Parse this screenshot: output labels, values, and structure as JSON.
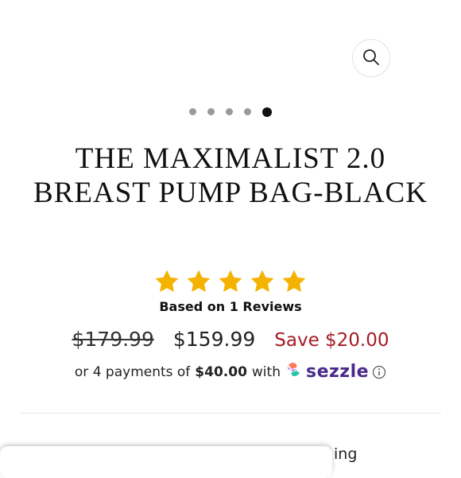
{
  "header": {
    "search_icon": "search-icon"
  },
  "carousel": {
    "total_dots": 5,
    "active_index": 4
  },
  "product": {
    "title": "THE MAXIMALIST 2.0 BREAST PUMP BAG-BLACK",
    "rating": {
      "stars": 5,
      "max": 5,
      "color": "#f5b301",
      "reviews_text": "Based on 1 Reviews"
    },
    "price": {
      "original": "$179.99",
      "current": "$159.99",
      "save": "Save $20.00",
      "save_color": "#a51c24"
    },
    "installments": {
      "prefix": "or 4 payments of",
      "amount": "$40.00",
      "suffix": "with",
      "provider": "sezzle",
      "info_icon": "info-icon"
    }
  },
  "bottom_peek_text": "ing"
}
